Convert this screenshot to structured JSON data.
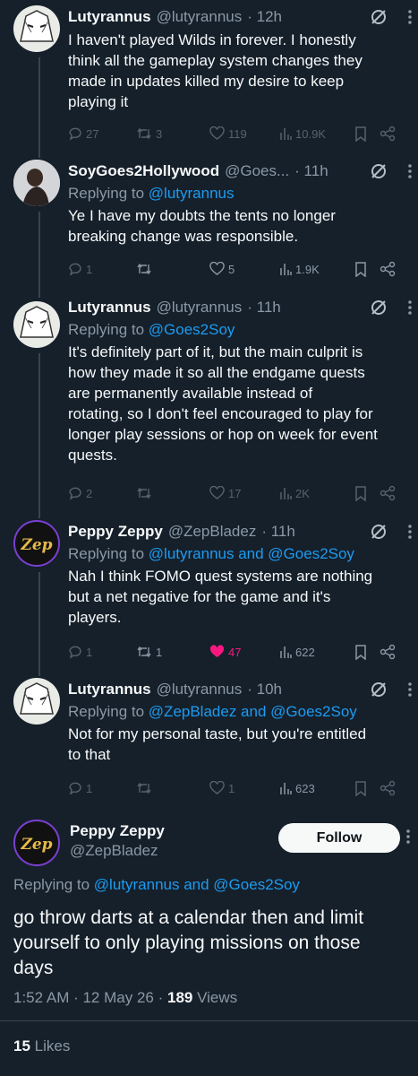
{
  "tweets": [
    {
      "name": "Lutyrannus",
      "handle": "@lutyrannus",
      "time": "· 12h",
      "replying_prefix": "",
      "replying_to": "",
      "lines": [
        "I haven't played Wilds in forever. I honestly",
        "think all the gameplay system changes they",
        "made in updates killed my desire to keep",
        "playing it"
      ],
      "replies": "27",
      "retweets": "3",
      "likes": "119",
      "views": "10.9K"
    },
    {
      "name": "SoyGoes2Hollywood",
      "handle": "@Goes...",
      "time": "· 11h",
      "replying_prefix": "Replying to",
      "replying_to": "@lutyrannus",
      "lines": [
        "Ye I have my doubts the tents no longer",
        "breaking change was responsible."
      ],
      "replies": "1",
      "retweets": "",
      "likes": "5",
      "views": "1.9K"
    },
    {
      "name": "Lutyrannus",
      "handle": "@lutyrannus",
      "time": "· 11h",
      "replying_prefix": "Replying to",
      "replying_to": "@Goes2Soy",
      "lines": [
        "It's definitely part of it, but the main culprit is",
        "how they made it so all the endgame quests",
        "are permanently available instead of",
        "rotating, so I don't feel encouraged to play for",
        "longer play sessions or hop on week for event",
        "quests."
      ],
      "replies": "2",
      "retweets": "",
      "likes": "17",
      "views": "2K"
    },
    {
      "name": "Peppy Zeppy",
      "handle": "@ZepBladez",
      "time": "· 11h",
      "replying_prefix": "Replying to",
      "replying_to": "@lutyrannus and @Goes2Soy",
      "lines": [
        "Nah I think FOMO quest systems are nothing",
        "but a net negative for the game and it's",
        "players."
      ],
      "replies": "1",
      "retweets": "1",
      "likes": "47",
      "views": "622"
    },
    {
      "name": "Lutyrannus",
      "handle": "@lutyrannus",
      "time": "· 10h",
      "replying_prefix": "Replying to",
      "replying_to": "@ZepBladez and @Goes2Soy",
      "lines": [
        "Not for my personal taste, but you're entitled",
        "to that"
      ],
      "replies": "1",
      "retweets": "",
      "likes": "1",
      "views": "623"
    }
  ],
  "main_tweet": {
    "name": "Peppy Zeppy",
    "handle": "@ZepBladez",
    "follow_label": "Follow",
    "replying_prefix": "Replying to",
    "replying_to": "@lutyrannus and @Goes2Soy",
    "lines": [
      "go throw darts at a calendar then and limit",
      "yourself to only playing missions on those",
      "days"
    ],
    "time": "1:52 AM · 12 May 26 ·",
    "views_count": "189",
    "views_label": "Views",
    "likes_count": "15",
    "likes_label": "Likes"
  },
  "avatar_text": "Zep",
  "colors": {
    "background": "#15202b",
    "link": "#1d9bf0",
    "like": "#f91880",
    "muted": "#8b98a5"
  },
  "icons": [
    "reply-icon",
    "retweet-icon",
    "heart-icon",
    "views-icon",
    "bookmark-icon",
    "share-icon",
    "grok-icon",
    "more-icon"
  ]
}
